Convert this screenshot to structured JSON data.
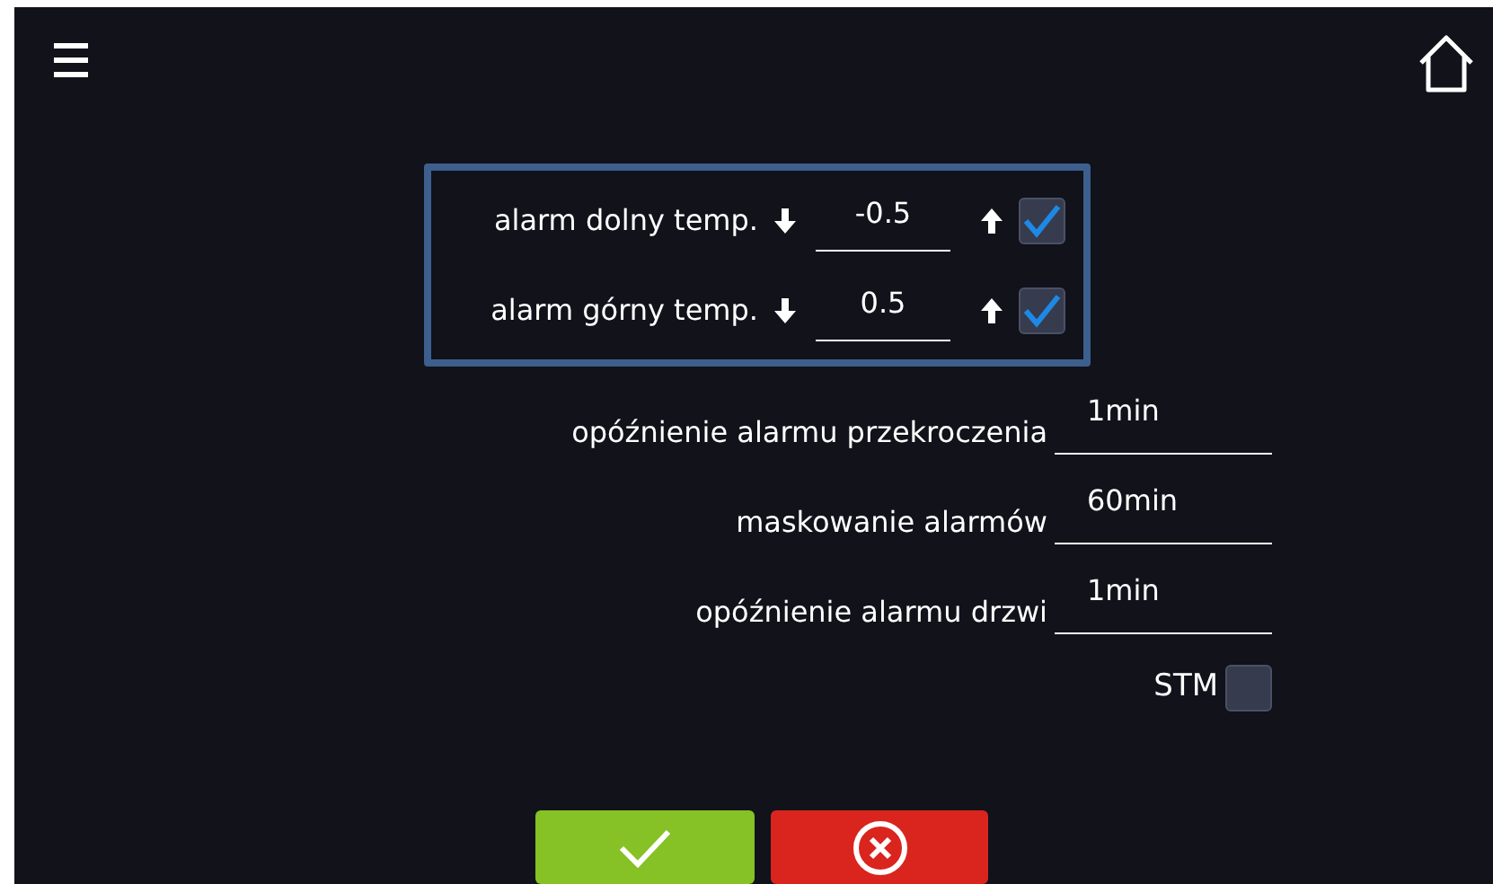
{
  "alarm_box": {
    "rows": [
      {
        "label": "alarm dolny temp.",
        "value": "-0.5",
        "checked": true
      },
      {
        "label": "alarm górny temp.",
        "value": "0.5",
        "checked": true
      }
    ]
  },
  "settings": [
    {
      "label": "opóźnienie alarmu przekroczenia",
      "value": "1min"
    },
    {
      "label": "maskowanie alarmów",
      "value": "60min"
    },
    {
      "label": "opóźnienie alarmu drzwi",
      "value": "1min"
    }
  ],
  "stm": {
    "label": "STM",
    "checked": false
  },
  "buttons": [
    {
      "kind": "confirm"
    },
    {
      "kind": "cancel"
    }
  ]
}
